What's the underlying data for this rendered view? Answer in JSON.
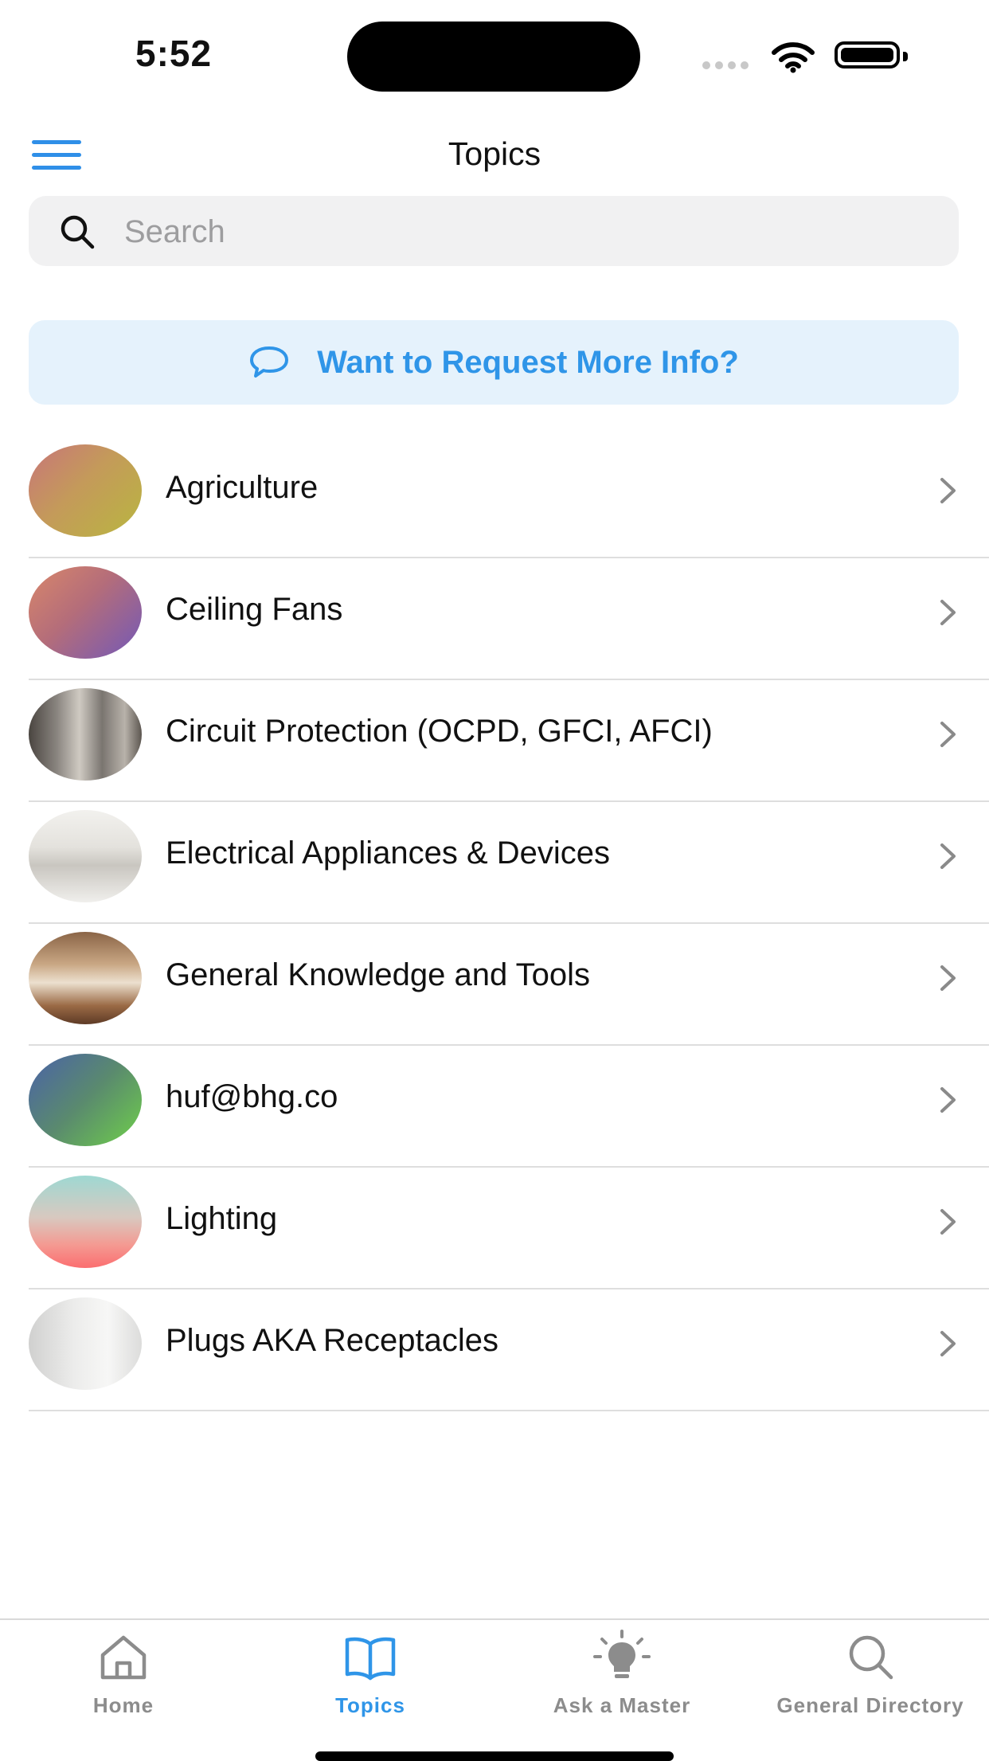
{
  "status_bar": {
    "time": "5:52"
  },
  "nav": {
    "title": "Topics"
  },
  "search": {
    "placeholder": "Search"
  },
  "request_banner": {
    "label": "Want to Request More Info?"
  },
  "colors": {
    "accent": "#2f95e8",
    "banner_bg": "#e5f2fc",
    "inactive_tab": "#8c8c8c"
  },
  "topics": [
    {
      "label": "Agriculture"
    },
    {
      "label": "Ceiling Fans"
    },
    {
      "label": "Circuit Protection (OCPD, GFCI, AFCI)"
    },
    {
      "label": "Electrical Appliances & Devices"
    },
    {
      "label": "General Knowledge and Tools"
    },
    {
      "label": "huf@bhg.co"
    },
    {
      "label": "Lighting"
    },
    {
      "label": "Plugs AKA Receptacles"
    }
  ],
  "tabs": [
    {
      "label": "Home",
      "icon": "home-icon",
      "active": false
    },
    {
      "label": "Topics",
      "icon": "book-icon",
      "active": true
    },
    {
      "label": "Ask a Master",
      "icon": "lightbulb-icon",
      "active": false
    },
    {
      "label": "General Directory",
      "icon": "search-icon",
      "active": false
    }
  ]
}
